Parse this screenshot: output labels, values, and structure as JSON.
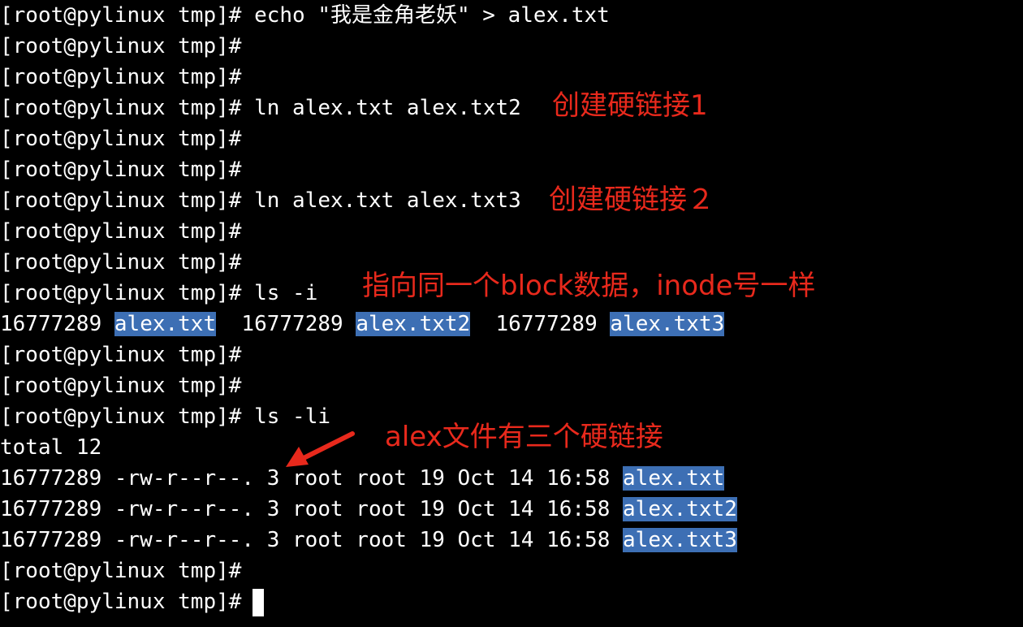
{
  "terminal": {
    "prompt": "[root@pylinux tmp]#",
    "lines": {
      "l0_cmd": " echo \"我是金角老妖\" > alex.txt",
      "l3_cmd": " ln alex.txt alex.txt2",
      "l6_cmd": " ln alex.txt alex.txt3",
      "l9_cmd": " ls -i",
      "l13_cmd": " ls -li"
    },
    "ls_i_output": {
      "inode1": "16777289 ",
      "file1": "alex.txt",
      "inode2": "  16777289 ",
      "file2": "alex.txt2",
      "inode3": "  16777289 ",
      "file3": "alex.txt3"
    },
    "ls_li_output": {
      "total": "total 12",
      "row1_meta": "16777289 -rw-r--r--. 3 root root 19 Oct 14 16:58 ",
      "row1_file": "alex.txt",
      "row2_meta": "16777289 -rw-r--r--. 3 root root 19 Oct 14 16:58 ",
      "row2_file": "alex.txt2",
      "row3_meta": "16777289 -rw-r--r--. 3 root root 19 Oct 14 16:58 ",
      "row3_file": "alex.txt3"
    }
  },
  "annotations": {
    "hardlink1": "创建硬链接1",
    "hardlink2": "创建硬链接２",
    "same_inode": "指向同一个block数据，inode号一样",
    "three_links": "alex文件有三个硬链接"
  },
  "colors": {
    "background": "#000000",
    "text": "#ffffff",
    "selection": "#3d6fb4",
    "annotation": "#e8291c"
  }
}
